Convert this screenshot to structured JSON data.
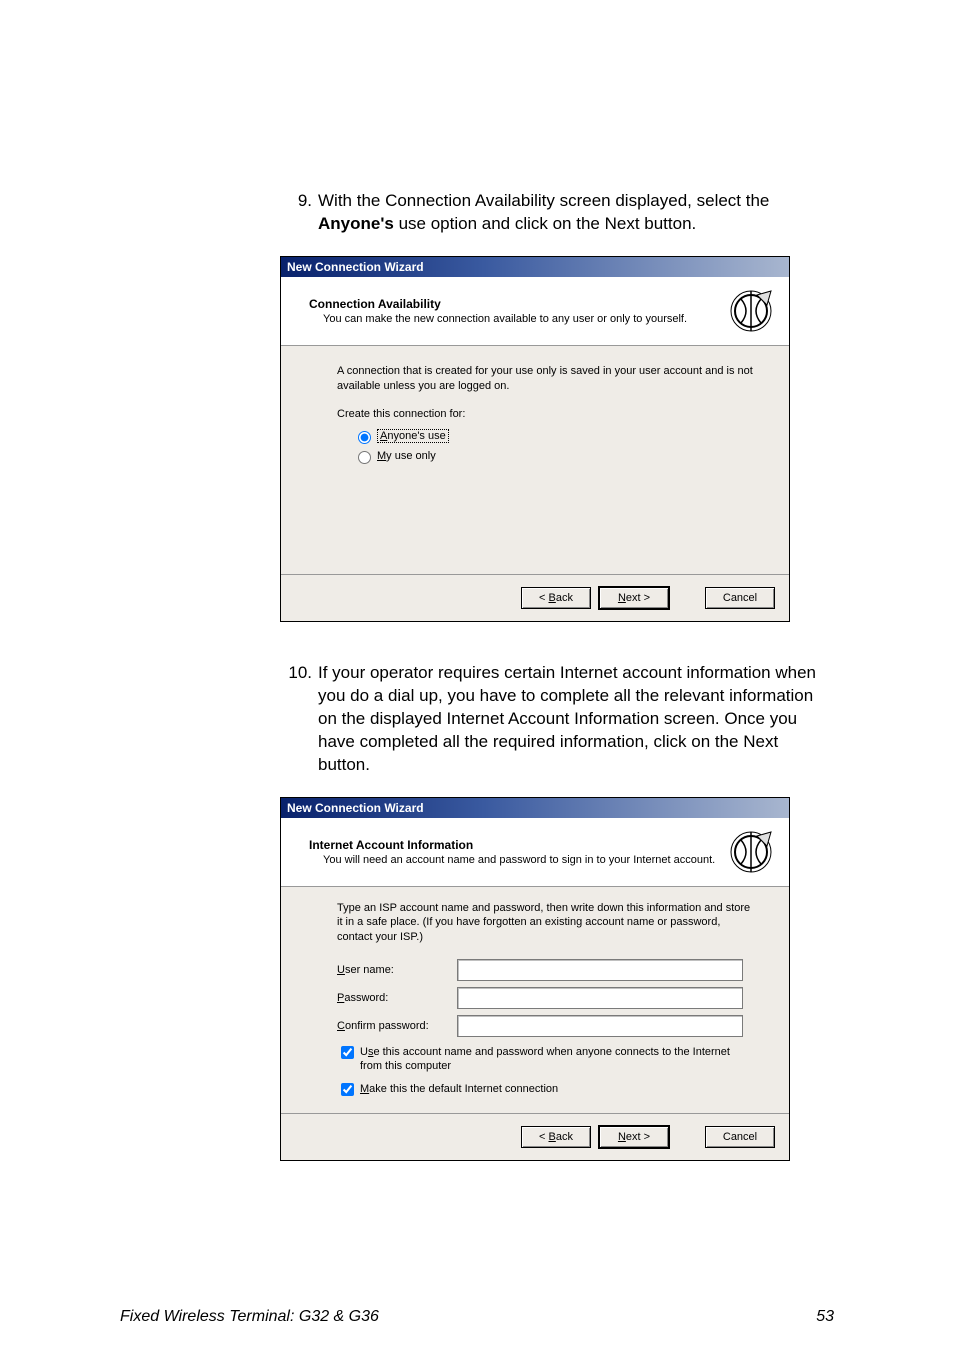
{
  "step9": {
    "number": "9.",
    "text_pre": "With the Connection Availability screen displayed, select the ",
    "bold": "Anyone's",
    "text_post": " use option and click on the Next button."
  },
  "wizard1": {
    "title": "New Connection Wizard",
    "header_title": "Connection Availability",
    "header_sub": "You can make the new connection available to any user or only to yourself.",
    "intro": "A connection that is created for your use only is saved in your user account and is not available unless you are logged on.",
    "group_label": "Create this connection for:",
    "radio1_u": "A",
    "radio1_rest": "nyone's use",
    "radio2_u": "M",
    "radio2_rest": "y use only",
    "back_lt": "< ",
    "back_u": "B",
    "back_rest": "ack",
    "next_u": "N",
    "next_rest": "ext >",
    "cancel": "Cancel"
  },
  "step10": {
    "number": "10.",
    "text": "If your operator requires certain Internet account information when you do a dial up, you have to complete all the relevant information on the displayed Internet Account Information screen.  Once you have completed all the required information, click on the Next button."
  },
  "wizard2": {
    "title": "New Connection Wizard",
    "header_title": "Internet Account Information",
    "header_sub": "You will need an account name and password to sign in to your Internet account.",
    "intro": "Type an ISP account name and password, then write down this information and store it in a safe place. (If you have forgotten an existing account name or password, contact your ISP.)",
    "user_u": "U",
    "user_rest": "ser name:",
    "pass_u": "P",
    "pass_rest": "assword:",
    "conf_u": "C",
    "conf_rest": "onfirm password:",
    "chk1_u": "s",
    "chk1_pre": "U",
    "chk1_rest": "e this account name and password when anyone connects to the Internet from this computer",
    "chk2_u": "M",
    "chk2_rest": "ake this the default Internet connection",
    "back_lt": "< ",
    "back_u": "B",
    "back_rest": "ack",
    "next_u": "N",
    "next_rest": "ext >",
    "cancel": "Cancel"
  },
  "footer": {
    "left": "Fixed Wireless Terminal: G32 & G36",
    "right": "53"
  }
}
